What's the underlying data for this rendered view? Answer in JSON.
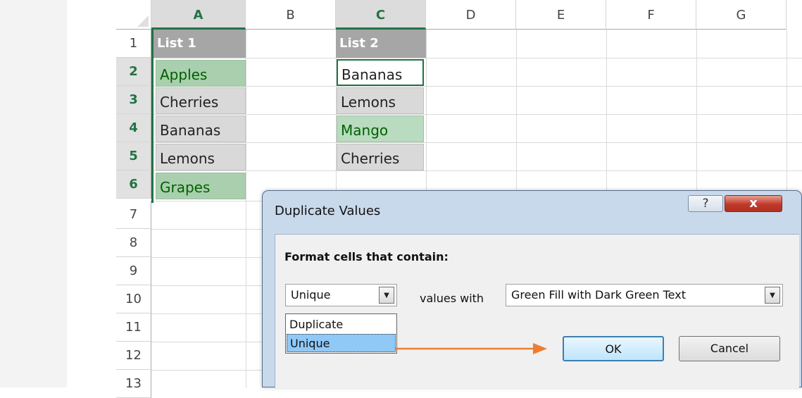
{
  "sheet": {
    "columns": [
      "A",
      "B",
      "C",
      "D",
      "E",
      "F",
      "G"
    ],
    "rows": [
      "1",
      "2",
      "3",
      "4",
      "5",
      "6",
      "7",
      "8",
      "9",
      "10",
      "11",
      "12",
      "13"
    ],
    "list1": {
      "header": "List 1",
      "items": [
        "Apples",
        "Cherries",
        "Bananas",
        "Lemons",
        "Grapes"
      ]
    },
    "list2": {
      "header": "List 2",
      "items": [
        "Bananas",
        "Lemons",
        "Mango",
        "Cherries"
      ]
    }
  },
  "dialog": {
    "title": "Duplicate Values",
    "help_icon": "?",
    "close_icon": "x",
    "format_label": "Format cells that contain:",
    "rule_select_value": "Unique",
    "values_with_label": "values with",
    "format_select_value": "Green Fill with Dark Green Text",
    "dropdown_options": [
      "Duplicate",
      "Unique"
    ],
    "ok_label": "OK",
    "cancel_label": "Cancel"
  },
  "colors": {
    "accent_green": "#217346",
    "green_fill": "#a9cfae",
    "dark_green_text": "#006100",
    "arrow_orange": "#ed7d31"
  }
}
